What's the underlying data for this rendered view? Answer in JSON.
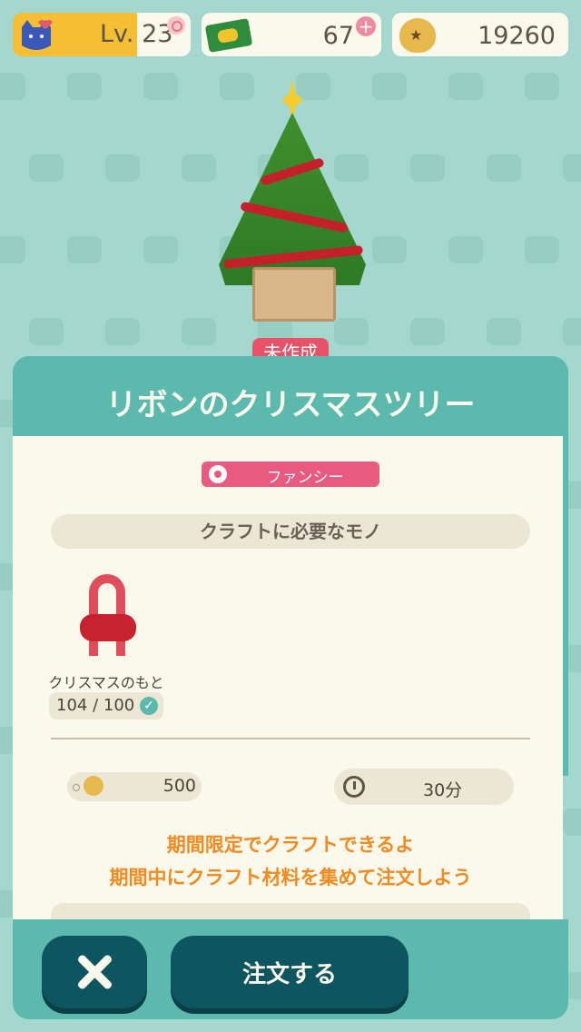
{
  "hud": {
    "level_label": "Lv. 23",
    "level_progress": 0.7,
    "tickets": "67",
    "bells": "19260"
  },
  "item": {
    "status": "未作成",
    "title": "リボンのクリスマスツリー",
    "category": "ファンシー"
  },
  "craft": {
    "section_title": "クラフトに必要なモノ",
    "material_name": "クリスマスのもと",
    "material_count": "104 / 100",
    "bell_cost": "500",
    "time": "30分"
  },
  "notice": {
    "line1": "期間限定でクラフトできるよ",
    "line2": "期間中にクラフト材料を集めて注文しよう"
  },
  "actions": {
    "order_label": "注文する"
  },
  "colors": {
    "teal": "#5bb9ad",
    "dark_teal": "#0d5660",
    "pink": "#e85a80",
    "orange": "#f18a21"
  }
}
